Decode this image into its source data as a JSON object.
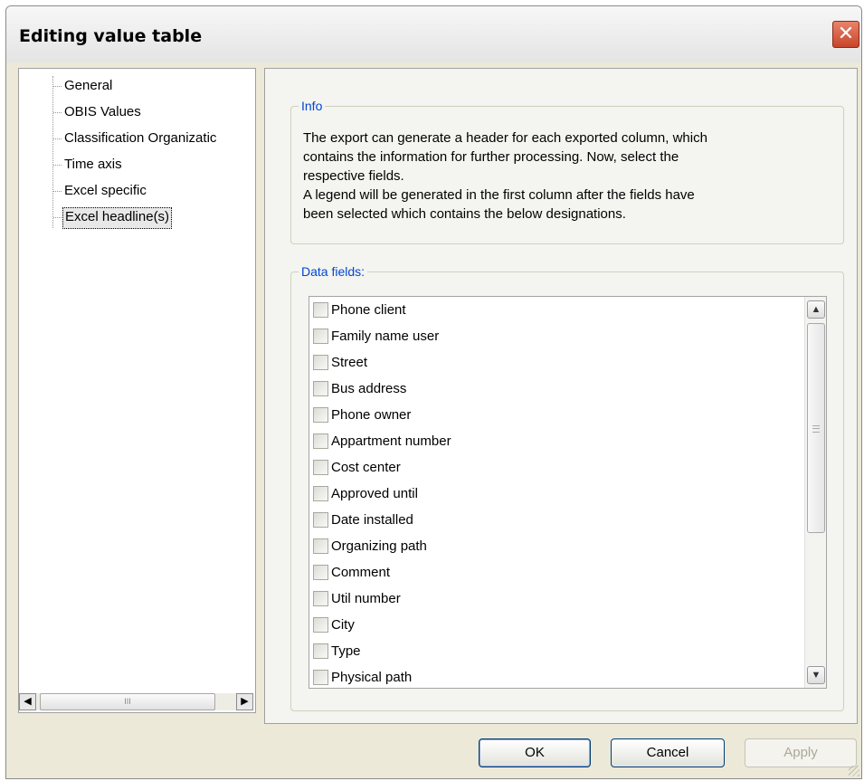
{
  "window": {
    "title": "Editing value table",
    "close_glyph": "✕"
  },
  "tree": {
    "items": [
      {
        "label": "General"
      },
      {
        "label": "OBIS Values"
      },
      {
        "label": "Classification Organizatic"
      },
      {
        "label": "Time axis"
      },
      {
        "label": "Excel specific"
      },
      {
        "label": "Excel headline(s)",
        "selected": true
      }
    ],
    "scroll_left_glyph": "◀",
    "scroll_right_glyph": "▶",
    "scroll_grip": "III"
  },
  "info": {
    "legend": "Info",
    "text_lines": [
      "The export can generate a header for each exported column, which",
      "contains the information for further processing. Now, select the",
      "respective fields.",
      "A legend will be generated in the first column after the fields have",
      "been selected which contains the below designations."
    ]
  },
  "data_fields": {
    "legend": "Data fields:",
    "items": [
      {
        "label": "Phone client",
        "checked": false
      },
      {
        "label": "Family name user",
        "checked": false
      },
      {
        "label": "Street",
        "checked": false
      },
      {
        "label": "Bus address",
        "checked": false
      },
      {
        "label": "Phone owner",
        "checked": false
      },
      {
        "label": "Appartment number",
        "checked": false
      },
      {
        "label": "Cost center",
        "checked": false
      },
      {
        "label": "Approved until",
        "checked": false
      },
      {
        "label": "Date installed",
        "checked": false
      },
      {
        "label": "Organizing path",
        "checked": false
      },
      {
        "label": "Comment",
        "checked": false
      },
      {
        "label": "Util number",
        "checked": false
      },
      {
        "label": "City",
        "checked": false
      },
      {
        "label": "Type",
        "checked": false
      },
      {
        "label": "Physical path",
        "checked": false
      }
    ],
    "scroll_up_glyph": "▲",
    "scroll_down_glyph": "▼"
  },
  "buttons": {
    "ok": "OK",
    "cancel": "Cancel",
    "apply": "Apply"
  }
}
